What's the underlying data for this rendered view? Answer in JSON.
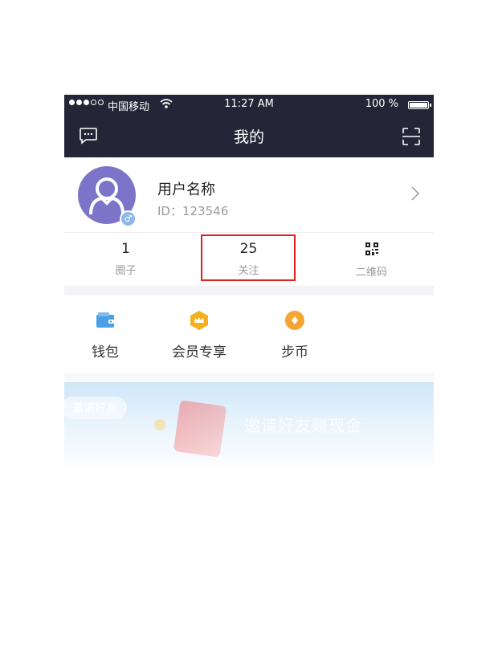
{
  "status_bar": {
    "carrier": "中国移动",
    "time": "11:27 AM",
    "battery_percent": "100 %"
  },
  "nav": {
    "title": "我的",
    "left_icon": "message-icon",
    "right_icon": "scan-icon"
  },
  "profile": {
    "username": "用户名称",
    "user_id": "ID：123546",
    "gender_symbol": "♂",
    "avatar_color": "#7b74c8"
  },
  "stats": [
    {
      "value": "1",
      "label": "圈子"
    },
    {
      "value": "25",
      "label": "关注"
    },
    {
      "icon": "qr-code-icon",
      "label": "二维码"
    }
  ],
  "menu": [
    {
      "label": "钱包",
      "icon": "wallet-icon",
      "color": "#4a9fe6"
    },
    {
      "label": "会员专享",
      "icon": "crown-badge-icon",
      "color": "#f5b020"
    },
    {
      "label": "步币",
      "icon": "coin-icon",
      "color": "#f5a531"
    }
  ],
  "banner": {
    "pill": "邀请好友",
    "title": "邀请好友赚现金"
  },
  "colors": {
    "nav_bg": "#242637",
    "highlight": "#e01f1f"
  }
}
